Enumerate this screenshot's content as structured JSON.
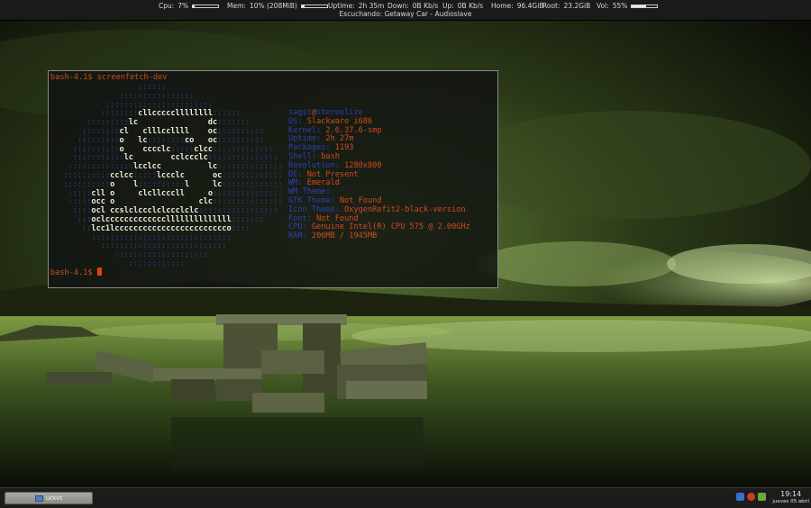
{
  "statusbar": {
    "cpu": {
      "label": "Cpu:",
      "value": "7%",
      "fraction": 0.07
    },
    "mem": {
      "label": "Mem:",
      "value": "10% (208MiB)",
      "fraction": 0.1
    },
    "uptime": {
      "label": "Uptime:",
      "value": "2h 35m"
    },
    "down": {
      "label": "Down:",
      "value": "0B Kb/s"
    },
    "up": {
      "label": "Up:",
      "value": "0B Kb/s"
    },
    "home": {
      "label": "Home:",
      "value": "96.4GiB"
    },
    "root": {
      "label": "Root:",
      "value": "23.2GiB"
    },
    "vol": {
      "label": "Vol:",
      "value": "55%",
      "fraction": 0.55
    },
    "now_playing": {
      "label": "Escuchando:",
      "value": "Getaway Car - Audioslave"
    }
  },
  "terminal": {
    "prompt": "bash-4.1$",
    "command": "screenfetch-dev",
    "logo_lines": [
      "                  ::::::",
      "              ::::::::::::::::",
      "           :::::::::::::::::::::::",
      "          ::::::::cllcccccllllllll::::::",
      "       :::::::::lc               dc:::::::",
      "      ::::::::cl   clllccllll    oc::::::::::",
      "     :::::::::o   lc::::::::co   oc::::::::::",
      "    ::::::::::o    cccclc:::::clcc:::::::::::::",
      "    :::::::::::lc        cclccclc:::::::::::::::",
      "   ::::::::::::::lcclcc          lc::::::::::::::",
      "  ::::::::::cclcc:::::lccclc      oc:::::::::::::",
      "  ::::::::::o    l::::::::::l     lc:::::::::::::",
      "   :::::cll o     clcllcccll     o:::::::::::::::",
      "   :::::occ o                  clc:::::::::::::::",
      "    ::::ocl ccslclccclclccclclc:::::::::::::::::",
      "     :::oclcccccccccccccllllllllllllll:::::::",
      "      ::lcc1lcccccccccccccccccccccccco::::",
      "        ::::::::::::::::::::::::::::::",
      "          :::::::::::::::::::::::::::",
      "             ::::::::::::::::::::",
      "                ::::::::::::"
    ],
    "info": {
      "user": "sagit",
      "at": "@",
      "host": "stereolize",
      "rows": [
        {
          "key": "OS:",
          "value": "Slackware i686"
        },
        {
          "key": "Kernel:",
          "value": "2.6.37.6-smp"
        },
        {
          "key": "Uptime:",
          "value": "2h 27m"
        },
        {
          "key": "Packages:",
          "value": "1193"
        },
        {
          "key": "Shell:",
          "value": "bash"
        },
        {
          "key": "Resolution:",
          "value": "1280x800"
        },
        {
          "key": "DE:",
          "value": "Not Present"
        },
        {
          "key": "WM:",
          "value": "Emerald"
        },
        {
          "key": "WM Theme:",
          "value": ""
        },
        {
          "key": "GTK Theme:",
          "value": "Not Found"
        },
        {
          "key": "Icon Theme:",
          "value": "OxygenRefit2-black-version"
        },
        {
          "key": "Font:",
          "value": "Not Found"
        },
        {
          "key": "CPU:",
          "value": "Genuine Intel(R) CPU 575 @ 2.00GHz"
        },
        {
          "key": "RAM:",
          "value": "206MB / 1945MB"
        }
      ]
    }
  },
  "taskbar": {
    "task_label": "urxvt",
    "clock_time": "19:14",
    "clock_date": "jueves 05 abril",
    "tray_icons": [
      "network-icon",
      "warning-icon",
      "update-icon"
    ]
  },
  "colors": {
    "prompt": "#d04a20",
    "info_key": "#2d3fb8",
    "logo_blue": "#2d3fb8",
    "logo_white": "#ecece0",
    "wallpaper_tint": "#6f8f2a"
  }
}
